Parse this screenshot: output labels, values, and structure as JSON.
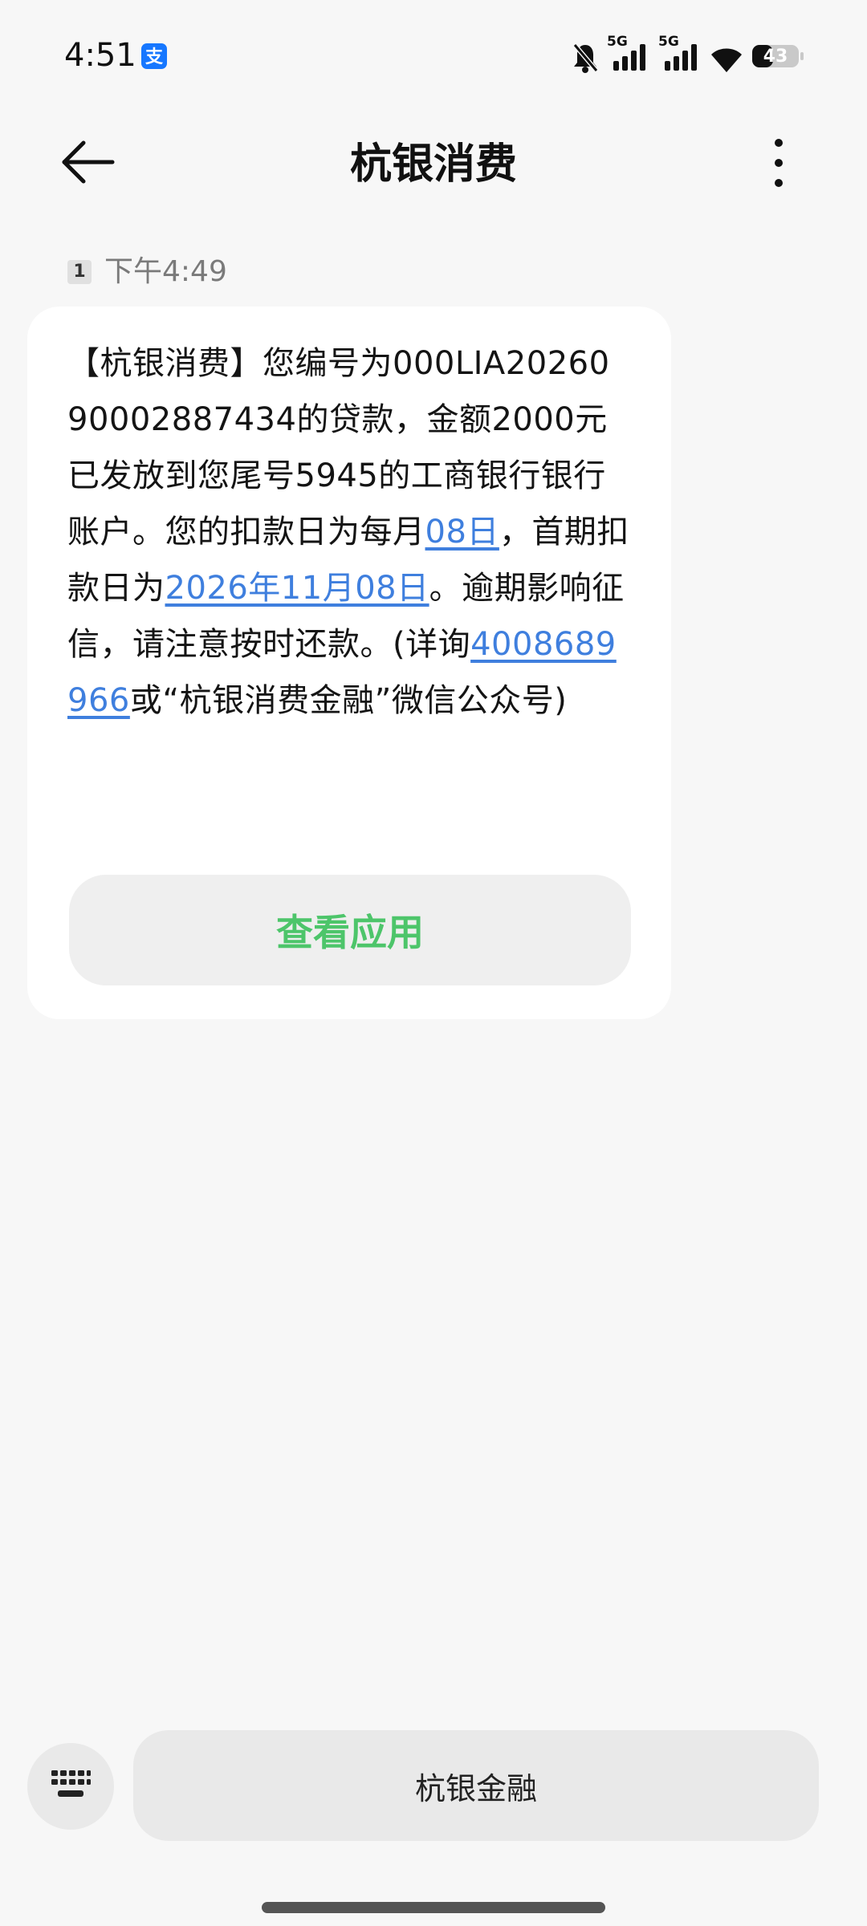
{
  "status_bar": {
    "time": "4:51",
    "network_1": "5G",
    "network_2": "5G",
    "battery": "43",
    "icons": [
      "alipay-icon",
      "bell-muted-icon",
      "signal-icon",
      "signal-icon",
      "wifi-icon",
      "battery-icon"
    ]
  },
  "header": {
    "title": "杭银消费",
    "back_icon": "back-arrow-icon",
    "more_icon": "more-vertical-icon"
  },
  "message": {
    "sim_slot": "1",
    "time": "下午4:49",
    "segments": {
      "s1": "【杭银消费】您编号为000LIA2026090002887434的贷款，金额2000元已发放到您尾号5945的工商银行银行账户。您的扣款日为每月",
      "link_day": "08日",
      "s2": "，首期扣款日为",
      "link_date": "2026年11月08日",
      "s3": "。逾期影响征信，请注意按时还款。(详询",
      "link_phone": "4008689966",
      "s4": "或“杭银消费金融”微信公众号)"
    },
    "action_button": "查看应用"
  },
  "bottom_bar": {
    "keyboard_icon": "keyboard-icon",
    "quick_reply": "杭银金融"
  },
  "colors": {
    "background": "#f7f7f7",
    "bubble": "#ffffff",
    "link": "#3f7fde",
    "action_text": "#4dc56a",
    "pill": "#e9e9e9"
  }
}
